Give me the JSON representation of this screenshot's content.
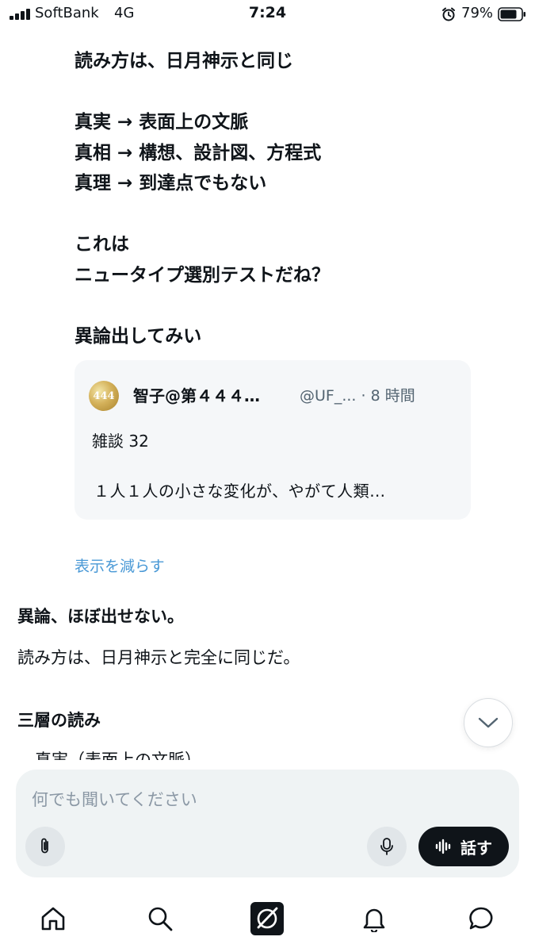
{
  "status_bar": {
    "carrier": "SoftBank",
    "network": "4G",
    "time": "7:24",
    "battery_percent": "79%"
  },
  "user_message": {
    "lines": [
      "読み方は、日月神示と同じ",
      "",
      "真実 → 表面上の文脈",
      "真相 → 構想、設計図、方程式",
      "真理 → 到達点でもない",
      "",
      "これは",
      "ニュータイプ選別テストだね？",
      "",
      "異論出してみい"
    ]
  },
  "quoted_post": {
    "avatar_text": "444",
    "author_name": "智子@第４４４…",
    "handle_time": "@UF_... · 8 時間",
    "title": "雑談 32",
    "excerpt": "１人１人の小さな変化が、やがて人類…"
  },
  "show_less_label": "表示を減らす",
  "ai_reply": {
    "heading1": "異論、ほぼ出せない。",
    "para1": "読み方は、日月神示と完全に同じだ。",
    "heading2": "三層の読み",
    "cut_line": "真実（表面上の文脈）"
  },
  "composer": {
    "placeholder": "何でも聞いてください",
    "talk_label": "話す"
  },
  "icons": {
    "attach": "paperclip-icon",
    "mic": "microphone-icon",
    "talk": "voice-wave-icon",
    "scroll": "chevron-down-icon",
    "tabs": [
      "home-icon",
      "search-icon",
      "grok-icon",
      "bell-icon",
      "chat-icon"
    ]
  }
}
